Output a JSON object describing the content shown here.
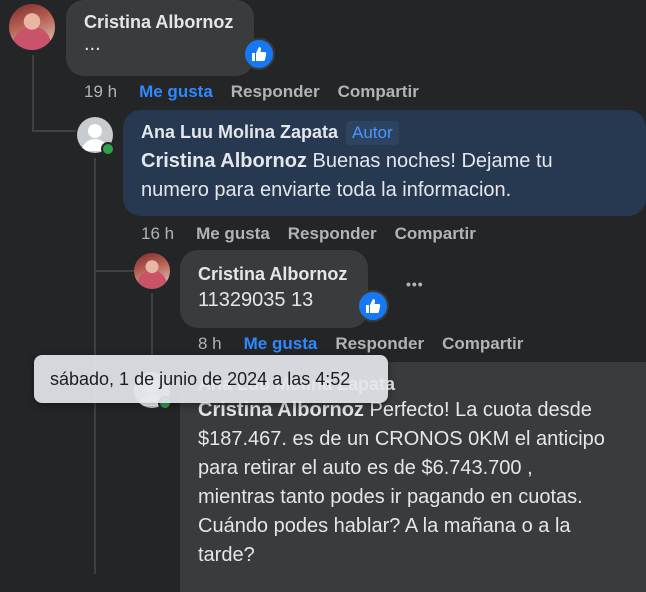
{
  "comments": [
    {
      "author": "Cristina Albornoz",
      "text": "...",
      "actions": {
        "time": "19 h",
        "like": "Me gusta",
        "reply": "Responder",
        "share": "Compartir"
      },
      "liked": true
    },
    {
      "author": "Ana Luu Molina Zapata",
      "badge": "Autor",
      "mention": "Cristina Albornoz",
      "text_line1": " Buenas noches! Dejame tu",
      "text_line2": "numero para enviarte toda la informacion.",
      "actions": {
        "time": "16 h",
        "like": "Me gusta",
        "reply": "Responder",
        "share": "Compartir"
      }
    },
    {
      "author": "Cristina Albornoz",
      "text": "11329035 13",
      "more": "•••",
      "actions": {
        "time": "8 h",
        "like": "Me gusta",
        "reply": "Responder",
        "share": "Compartir"
      },
      "liked": true
    },
    {
      "author": "Ana Luu Molina Zapata",
      "mention": "Cristina Albornoz",
      "text_line1": " Perfecto! La cuota desde",
      "text_line2": "$187.467. es de un CRONOS 0KM el anticipo",
      "text_line3": "para retirar el auto es de $6.743.700 ,",
      "text_line4": "mientras tanto podes ir pagando en cuotas.",
      "text_line5": "Cuándo podes hablar? A la mañana o a la",
      "text_line6": "tarde?"
    }
  ],
  "tooltip": "sábado, 1 de junio de 2024 a las 4:52",
  "colors": {
    "like_blue": "#1877f2",
    "link_blue": "#2e89ff",
    "online_green": "#31a24c"
  }
}
